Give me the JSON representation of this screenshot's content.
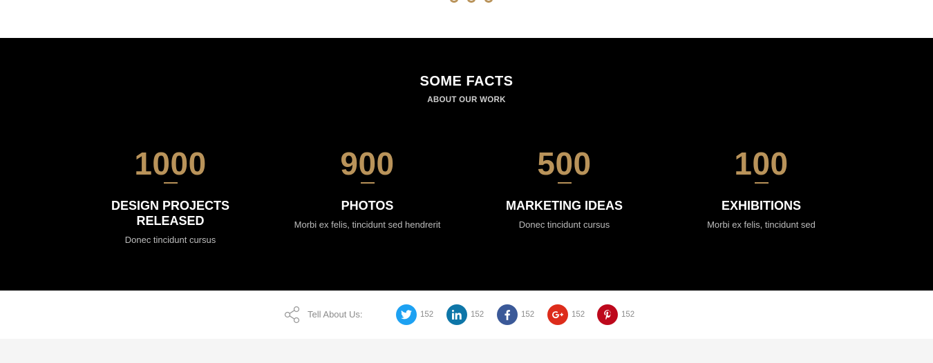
{
  "colors": {
    "accent": "#b9935a",
    "facts_bg": "#000000",
    "twitter": "#1da1f2",
    "linkedin": "#0e76a8",
    "facebook": "#3b5998",
    "googleplus": "#dd2c1b",
    "pinterest": "#bd081c"
  },
  "facts": {
    "title": "SOME FACTS",
    "subtitle": "ABOUT OUR WORK",
    "stats": [
      {
        "number": "1000",
        "title": "DESIGN PROJECTS RELEASED",
        "desc": "Donec tincidunt cursus"
      },
      {
        "number": "900",
        "title": "PHOTOS",
        "desc": "Morbi ex felis, tincidunt sed hendrerit"
      },
      {
        "number": "500",
        "title": "MARKETING IDEAS",
        "desc": "Donec tincidunt cursus"
      },
      {
        "number": "100",
        "title": "EXHIBITIONS",
        "desc": "Morbi ex felis, tincidunt sed"
      }
    ]
  },
  "share": {
    "label": "Tell About Us:",
    "icon": "share-icon",
    "networks": [
      {
        "name": "twitter",
        "icon": "twitter-icon",
        "count": "152"
      },
      {
        "name": "linkedin",
        "icon": "linkedin-icon",
        "count": "152"
      },
      {
        "name": "facebook",
        "icon": "facebook-icon",
        "count": "152"
      },
      {
        "name": "googleplus",
        "icon": "google-plus-icon",
        "count": "152"
      },
      {
        "name": "pinterest",
        "icon": "pinterest-icon",
        "count": "152"
      }
    ]
  }
}
